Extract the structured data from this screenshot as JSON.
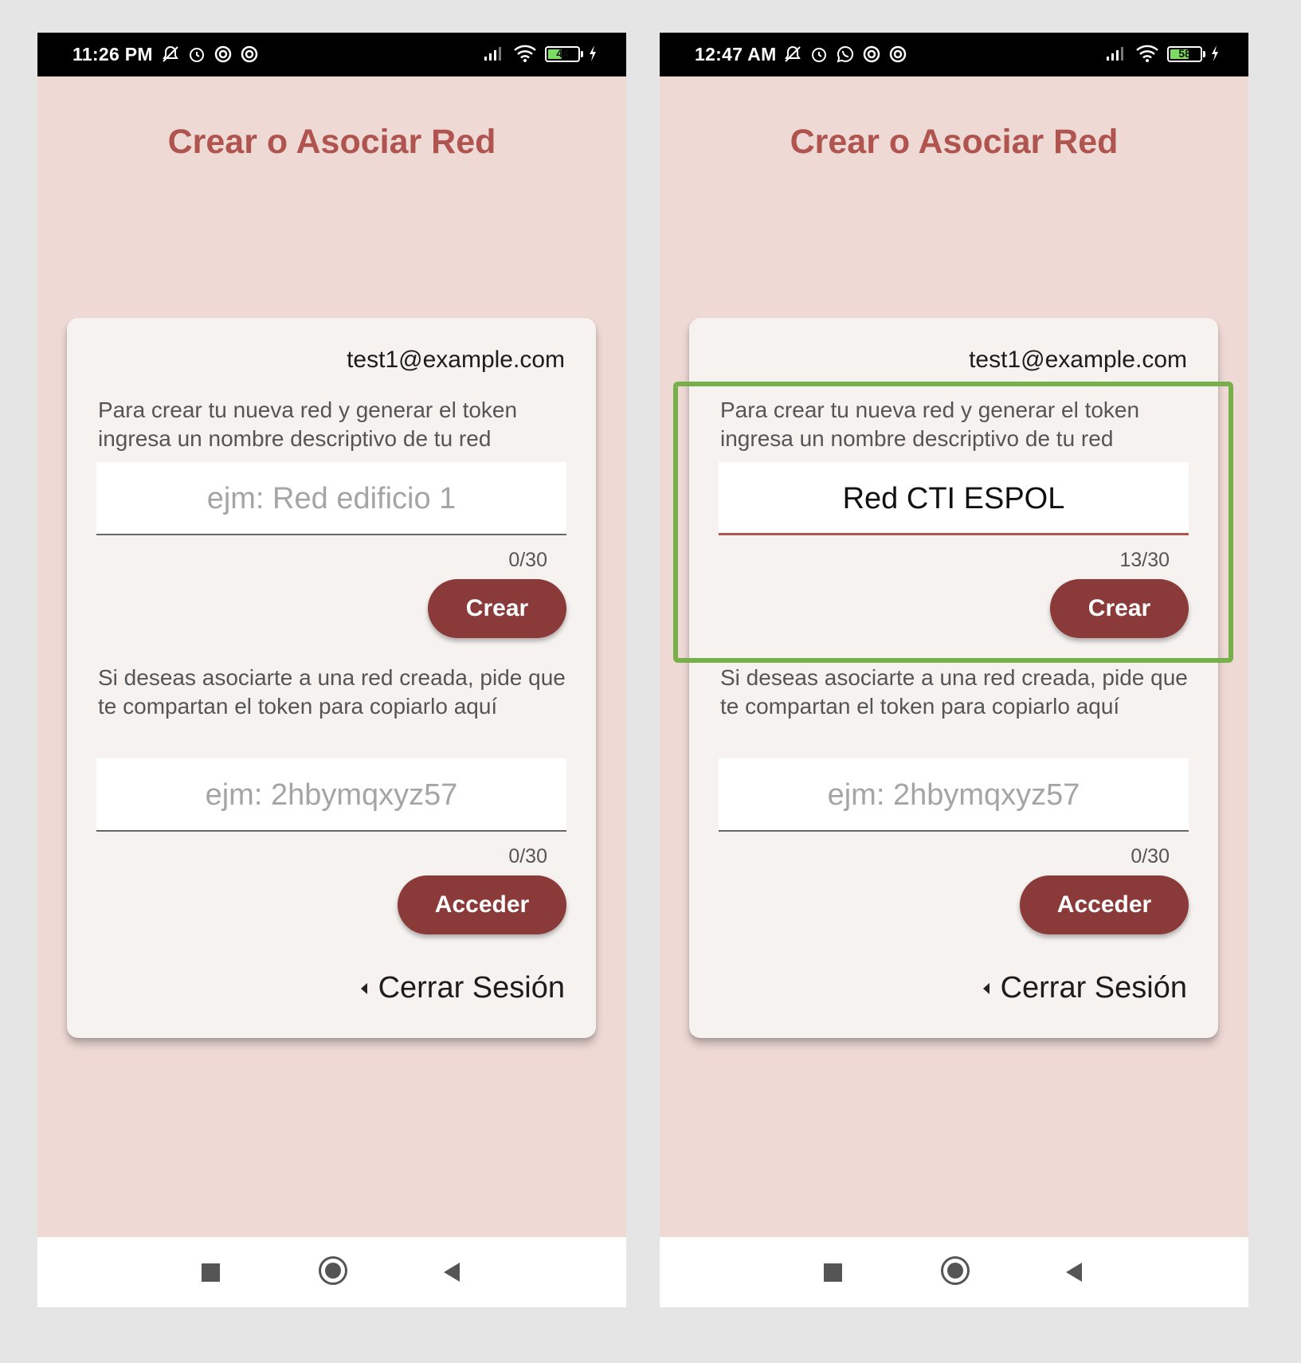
{
  "screens": [
    {
      "status": {
        "time": "11:26 PM",
        "battery": "44",
        "battery_level": 0.44
      },
      "title": "Crear o Asociar Red",
      "email": "test1@example.com",
      "create": {
        "instructions": "Para crear tu nueva red y generar el token ingresa un nombre descriptivo de tu red",
        "placeholder": "ejm: Red edificio 1",
        "value": "",
        "counter": "0/30",
        "button": "Crear"
      },
      "join": {
        "instructions": "Si deseas asociarte a una red creada, pide que te compartan el token para copiarlo aquí",
        "placeholder": "ejm: 2hbymqxyz57",
        "value": "",
        "counter": "0/30",
        "button": "Acceder"
      },
      "logout": "Cerrar Sesión"
    },
    {
      "status": {
        "time": "12:47 AM",
        "battery": "58",
        "battery_level": 0.58
      },
      "title": "Crear o Asociar Red",
      "email": "test1@example.com",
      "create": {
        "instructions": "Para crear tu nueva red y generar el token ingresa un nombre descriptivo de tu red",
        "placeholder": "ejm: Red edificio 1",
        "value": "Red CTI ESPOL",
        "counter": "13/30",
        "button": "Crear"
      },
      "join": {
        "instructions": "Si deseas asociarte a una red creada, pide que te compartan el token para copiarlo aquí",
        "placeholder": "ejm: 2hbymqxyz57",
        "value": "",
        "counter": "0/30",
        "button": "Acceder"
      },
      "logout": "Cerrar Sesión"
    }
  ],
  "colors": {
    "background": "#eed9d5",
    "accent": "#8b3a3a",
    "title": "#b0544f",
    "highlight": "#77b04a"
  }
}
